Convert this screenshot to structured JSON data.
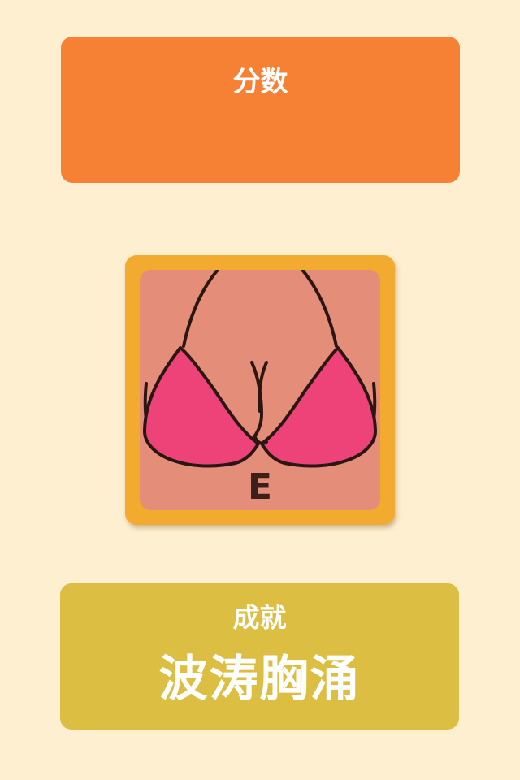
{
  "score_panel": {
    "title": "分数",
    "value": "",
    "color": "#F68135"
  },
  "result_card": {
    "cup_letter": "E",
    "frame_color": "#F2AB2F",
    "skin_color": "#E48E79",
    "bra_color": "#EE4379",
    "outline_color": "#2A1712"
  },
  "achievement_panel": {
    "title": "成就",
    "name": "波涛胸涌",
    "color": "#DBBE42"
  },
  "background_color": "#FEEFD0"
}
